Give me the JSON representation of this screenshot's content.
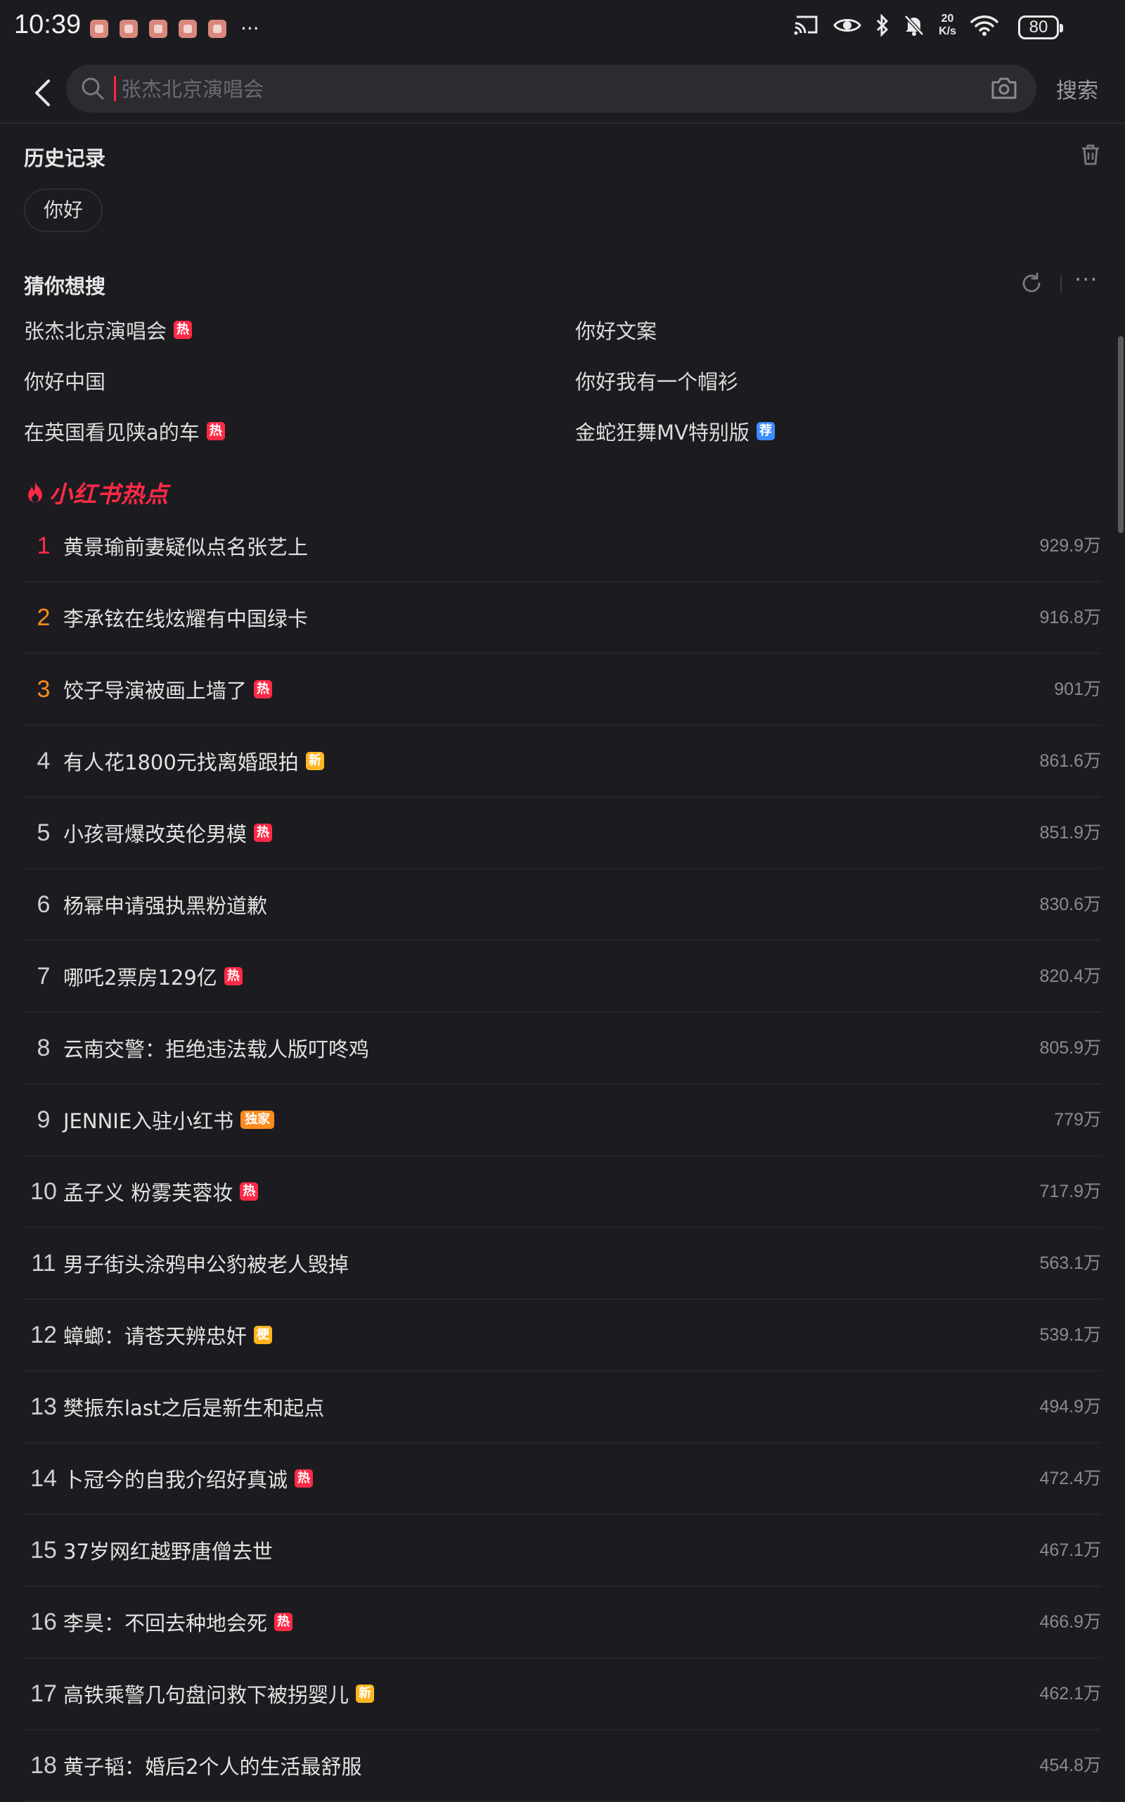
{
  "status_bar": {
    "time": "10:39",
    "net_speed_value": "20",
    "net_speed_unit": "K/s",
    "battery": "80",
    "icons": [
      "screen-cast-icon",
      "eye-icon",
      "bluetooth-icon",
      "mute-icon",
      "wifi-icon"
    ]
  },
  "search": {
    "placeholder": "张杰北京演唱会",
    "button_label": "搜索"
  },
  "history": {
    "title": "历史记录",
    "items": [
      "你好"
    ]
  },
  "guess": {
    "title": "猜你想搜",
    "items": [
      {
        "text": "张杰北京演唱会",
        "tag": "热"
      },
      {
        "text": "你好文案",
        "tag": ""
      },
      {
        "text": "你好中国",
        "tag": ""
      },
      {
        "text": "你好我有一个帽衫",
        "tag": ""
      },
      {
        "text": "在英国看见陕a的车",
        "tag": "热"
      },
      {
        "text": "金蛇狂舞MV特别版",
        "tag": "荐"
      }
    ]
  },
  "hot": {
    "title": "小红书热点",
    "items": [
      {
        "rank": "1",
        "text": "黄景瑜前妻疑似点名张艺上",
        "tag": "",
        "count": "929.9万"
      },
      {
        "rank": "2",
        "text": "李承铉在线炫耀有中国绿卡",
        "tag": "",
        "count": "916.8万"
      },
      {
        "rank": "3",
        "text": "饺子导演被画上墙了",
        "tag": "热",
        "count": "901万"
      },
      {
        "rank": "4",
        "text": "有人花1800元找离婚跟拍",
        "tag": "新",
        "count": "861.6万"
      },
      {
        "rank": "5",
        "text": "小孩哥爆改英伦男模",
        "tag": "热",
        "count": "851.9万"
      },
      {
        "rank": "6",
        "text": "杨幂申请强执黑粉道歉",
        "tag": "",
        "count": "830.6万"
      },
      {
        "rank": "7",
        "text": "哪吒2票房129亿",
        "tag": "热",
        "count": "820.4万"
      },
      {
        "rank": "8",
        "text": "云南交警：拒绝违法载人版叮咚鸡",
        "tag": "",
        "count": "805.9万"
      },
      {
        "rank": "9",
        "text": "JENNIE入驻小红书",
        "tag": "独家",
        "count": "779万"
      },
      {
        "rank": "10",
        "text": "孟子义 粉雾芙蓉妆",
        "tag": "热",
        "count": "717.9万"
      },
      {
        "rank": "11",
        "text": "男子街头涂鸦申公豹被老人毁掉",
        "tag": "",
        "count": "563.1万"
      },
      {
        "rank": "12",
        "text": "蟑螂：请苍天辨忠奸",
        "tag": "梗",
        "count": "539.1万"
      },
      {
        "rank": "13",
        "text": "樊振东last之后是新生和起点",
        "tag": "",
        "count": "494.9万"
      },
      {
        "rank": "14",
        "text": "卜冠今的自我介绍好真诚",
        "tag": "热",
        "count": "472.4万"
      },
      {
        "rank": "15",
        "text": "37岁网红越野唐僧去世",
        "tag": "",
        "count": "467.1万"
      },
      {
        "rank": "16",
        "text": "李昊：不回去种地会死",
        "tag": "热",
        "count": "466.9万"
      },
      {
        "rank": "17",
        "text": "高铁乘警几句盘问救下被拐婴儿",
        "tag": "新",
        "count": "462.1万"
      },
      {
        "rank": "18",
        "text": "黄子韬：婚后2个人的生活最舒服",
        "tag": "",
        "count": "454.8万"
      }
    ]
  }
}
